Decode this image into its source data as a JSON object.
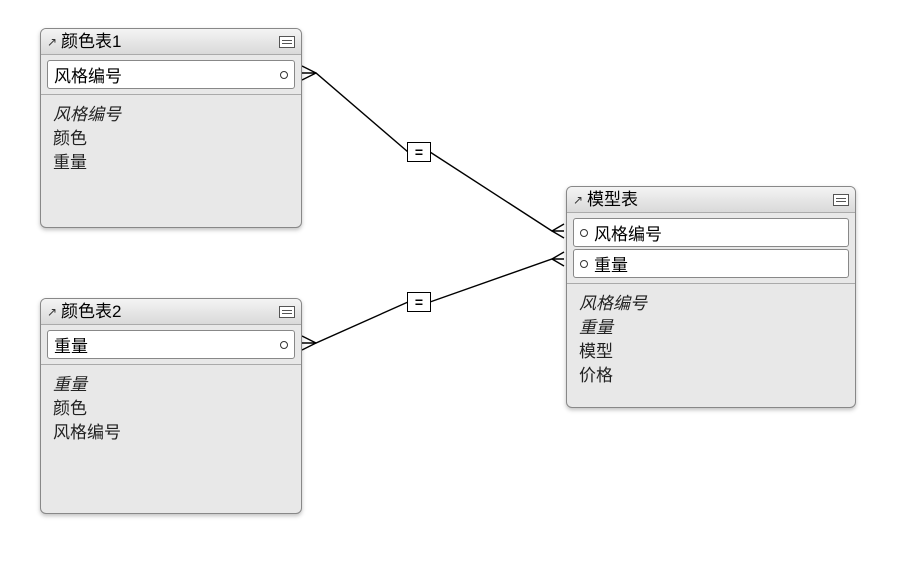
{
  "diagram": {
    "tables": {
      "colorTable1": {
        "title": "颜色表1",
        "keys": [
          {
            "label": "风格编号",
            "side": "right"
          }
        ],
        "fields": [
          {
            "label": "风格编号",
            "pk": true
          },
          {
            "label": "颜色",
            "pk": false
          },
          {
            "label": "重量",
            "pk": false
          }
        ]
      },
      "colorTable2": {
        "title": "颜色表2",
        "keys": [
          {
            "label": "重量",
            "side": "right"
          }
        ],
        "fields": [
          {
            "label": "重量",
            "pk": true
          },
          {
            "label": "颜色",
            "pk": false
          },
          {
            "label": "风格编号",
            "pk": false
          }
        ]
      },
      "modelTable": {
        "title": "模型表",
        "keys": [
          {
            "label": "风格编号",
            "side": "left"
          },
          {
            "label": "重量",
            "side": "left"
          }
        ],
        "fields": [
          {
            "label": "风格编号",
            "pk": true
          },
          {
            "label": "重量",
            "pk": true
          },
          {
            "label": "模型",
            "pk": false
          },
          {
            "label": "价格",
            "pk": false
          }
        ]
      }
    },
    "operators": {
      "op1": "=",
      "op2": "="
    }
  }
}
